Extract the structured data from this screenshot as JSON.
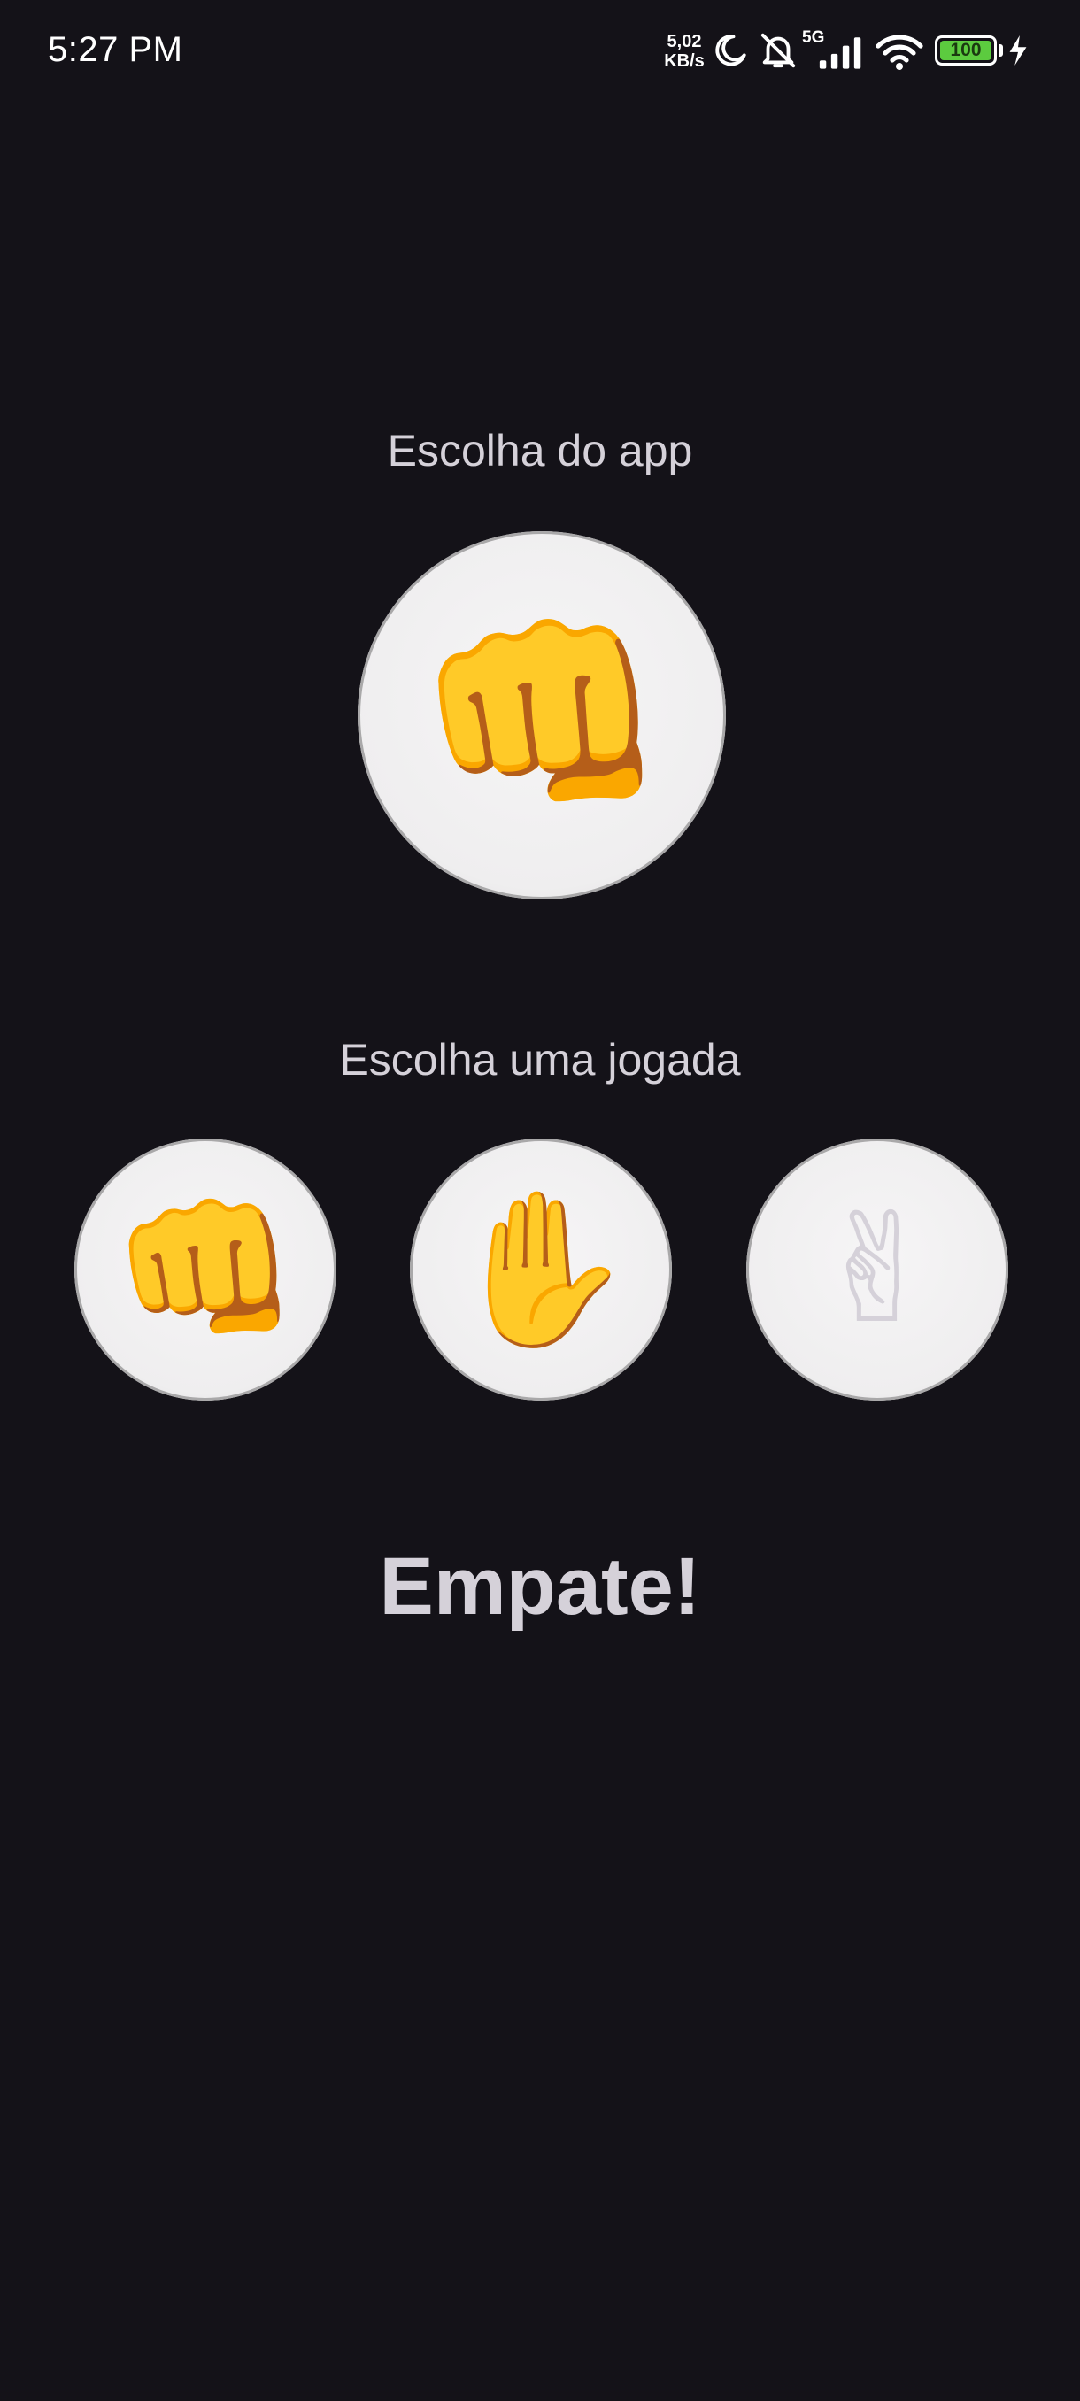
{
  "status_bar": {
    "time": "5:27 PM",
    "net_speed_value": "5,02",
    "net_speed_unit": "KB/s",
    "network_type": "5G",
    "battery_level": "100",
    "icons": [
      "moon-icon",
      "bell-off-icon",
      "signal-icon",
      "wifi-icon",
      "battery-icon",
      "charging-bolt-icon"
    ]
  },
  "game": {
    "app_label": "Escolha do app",
    "app_choice": {
      "name": "pedra",
      "emoji": "👊"
    },
    "user_label": "Escolha uma jogada",
    "options": [
      {
        "name": "pedra",
        "emoji": "👊"
      },
      {
        "name": "papel",
        "emoji": "✋"
      },
      {
        "name": "tesoura",
        "emoji": "✌"
      }
    ],
    "result": "Empate!"
  },
  "colors": {
    "background": "#141218",
    "text": "#d5d1d9",
    "circle": "#efeeef",
    "battery_fill": "#5ccb3f"
  }
}
